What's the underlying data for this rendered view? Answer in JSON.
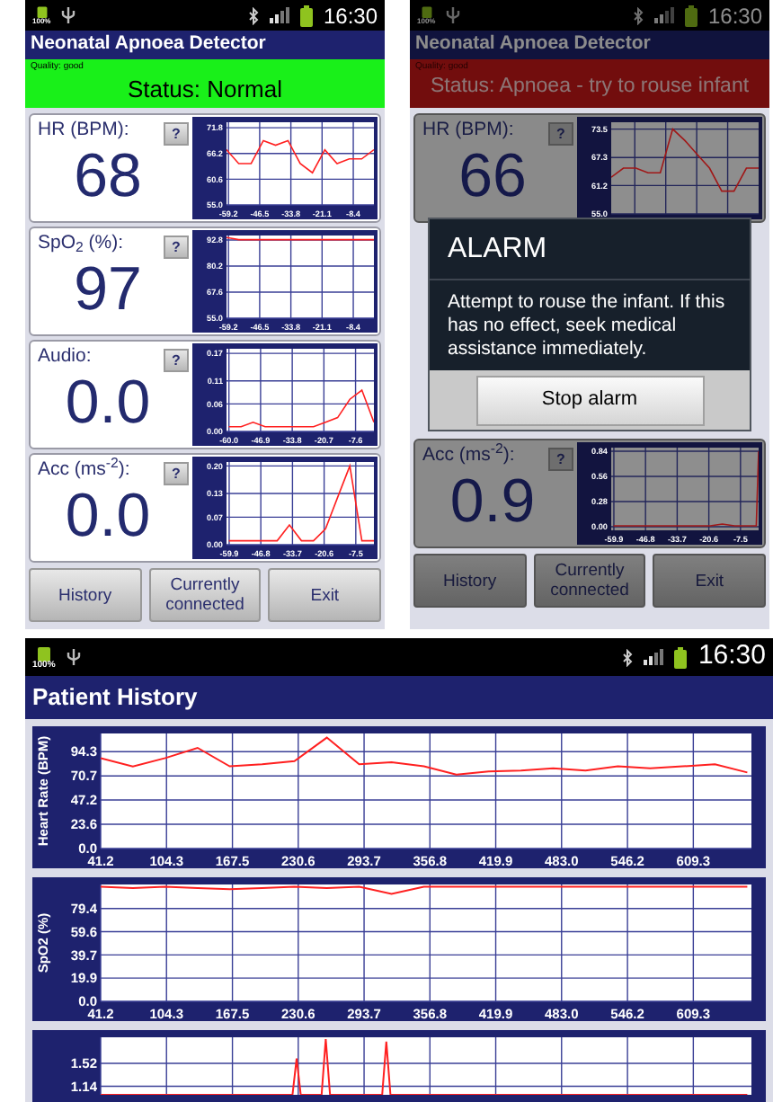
{
  "phones": [
    {
      "kind": "monitor",
      "dimmed": false,
      "status_bar": {
        "battery_label": "100%",
        "time": "16:30"
      },
      "title": "Neonatal Apnoea Detector",
      "quality": "Quality: good",
      "status": {
        "text": "Status: Normal",
        "alert": false
      },
      "cards_above": [
        {
          "label": "HR (BPM):",
          "value": "68",
          "help": "?",
          "chart_data": {
            "type": "line",
            "grid": true,
            "xlim": [
              -60,
              0
            ],
            "ylim": [
              55,
              73
            ],
            "x": [
              -60,
              -55,
              -50,
              -45,
              -40,
              -35,
              -30,
              -25,
              -20,
              -15,
              -10,
              -5,
              0
            ],
            "xticks": [
              {
                "value": -59.2,
                "label": "-59.2"
              },
              {
                "value": -46.5,
                "label": "-46.5"
              },
              {
                "value": -33.8,
                "label": "-33.8"
              },
              {
                "value": -21.1,
                "label": "-21.1"
              },
              {
                "value": -8.4,
                "label": "-8.4"
              }
            ],
            "yticks": [
              {
                "value": 55,
                "label": "55.0"
              },
              {
                "value": 60.6,
                "label": "60.6"
              },
              {
                "value": 66.2,
                "label": "66.2"
              },
              {
                "value": 71.8,
                "label": "71.8"
              }
            ],
            "series": [
              {
                "color": "#ff2020",
                "values": [
                  67,
                  64,
                  64,
                  69,
                  68,
                  69,
                  64,
                  62,
                  67,
                  64,
                  65,
                  65,
                  67
                ]
              }
            ]
          }
        },
        {
          "label": "SpO$_{2}$ (%):",
          "value": "97",
          "help": "?",
          "chart_data": {
            "type": "line",
            "grid": true,
            "xlim": [
              -60,
              0
            ],
            "ylim": [
              55,
              95
            ],
            "x": [
              -60,
              -55,
              -50,
              -45,
              -40,
              -35,
              -30,
              -25,
              -20,
              -15,
              -10,
              -5,
              0
            ],
            "xticks": [
              {
                "value": -59.2,
                "label": "-59.2"
              },
              {
                "value": -46.5,
                "label": "-46.5"
              },
              {
                "value": -33.8,
                "label": "-33.8"
              },
              {
                "value": -21.1,
                "label": "-21.1"
              },
              {
                "value": -8.4,
                "label": "-8.4"
              }
            ],
            "yticks": [
              {
                "value": 55,
                "label": "55.0"
              },
              {
                "value": 67.6,
                "label": "67.6"
              },
              {
                "value": 80.2,
                "label": "80.2"
              },
              {
                "value": 92.8,
                "label": "92.8"
              }
            ],
            "series": [
              {
                "color": "#ff2020",
                "values": [
                  94,
                  93,
                  93,
                  93,
                  93,
                  93,
                  93,
                  93,
                  93,
                  93,
                  93,
                  93,
                  93
                ]
              }
            ]
          }
        },
        {
          "label": "Audio:",
          "value": "0.0",
          "help": "?",
          "chart_data": {
            "type": "line",
            "grid": true,
            "xlim": [
              -61,
              0
            ],
            "ylim": [
              0,
              0.18
            ],
            "x": [
              -60,
              -55,
              -50,
              -45,
              -40,
              -35,
              -30,
              -25,
              -20,
              -15,
              -10,
              -5,
              0
            ],
            "xticks": [
              {
                "value": -60,
                "label": "-60.0"
              },
              {
                "value": -46.9,
                "label": "-46.9"
              },
              {
                "value": -33.8,
                "label": "-33.8"
              },
              {
                "value": -20.7,
                "label": "-20.7"
              },
              {
                "value": -7.6,
                "label": "-7.6"
              }
            ],
            "yticks": [
              {
                "value": 0,
                "label": "0.00"
              },
              {
                "value": 0.06,
                "label": "0.06"
              },
              {
                "value": 0.11,
                "label": "0.11"
              },
              {
                "value": 0.17,
                "label": "0.17"
              }
            ],
            "series": [
              {
                "color": "#ff2020",
                "values": [
                  0.01,
                  0.01,
                  0.02,
                  0.01,
                  0.01,
                  0.01,
                  0.01,
                  0.01,
                  0.02,
                  0.03,
                  0.07,
                  0.09,
                  0.02
                ]
              }
            ]
          }
        },
        {
          "label": "Acc (ms$^{-2}$):",
          "value": "0.0",
          "help": "?",
          "chart_data": {
            "type": "line",
            "grid": true,
            "xlim": [
              -61,
              0
            ],
            "ylim": [
              0,
              0.21
            ],
            "x": [
              -60,
              -55,
              -50,
              -45,
              -40,
              -35,
              -30,
              -25,
              -20,
              -15,
              -10,
              -5,
              0
            ],
            "xticks": [
              {
                "value": -59.9,
                "label": "-59.9"
              },
              {
                "value": -46.8,
                "label": "-46.8"
              },
              {
                "value": -33.7,
                "label": "-33.7"
              },
              {
                "value": -20.6,
                "label": "-20.6"
              },
              {
                "value": -7.5,
                "label": "-7.5"
              }
            ],
            "yticks": [
              {
                "value": 0,
                "label": "0.00"
              },
              {
                "value": 0.07,
                "label": "0.07"
              },
              {
                "value": 0.13,
                "label": "0.13"
              },
              {
                "value": 0.2,
                "label": "0.20"
              }
            ],
            "series": [
              {
                "color": "#ff2020",
                "values": [
                  0.01,
                  0.01,
                  0.01,
                  0.01,
                  0.01,
                  0.05,
                  0.01,
                  0.01,
                  0.04,
                  0.12,
                  0.2,
                  0.01,
                  0.01
                ]
              }
            ]
          }
        }
      ],
      "buttons": [
        "History",
        "Currently connected",
        "Exit"
      ]
    },
    {
      "kind": "monitor",
      "dimmed": true,
      "status_bar": {
        "battery_label": "100%",
        "time": "16:30"
      },
      "title": "Neonatal Apnoea Detector",
      "quality": "Quality: good",
      "status": {
        "text": "Status: Apnoea - try to rouse infant",
        "alert": true
      },
      "cards_above": [
        {
          "label": "HR (BPM):",
          "value": "66",
          "help": "?",
          "chart_data": {
            "type": "line",
            "grid": true,
            "ylim": [
              55,
              75
            ],
            "categories": [
              null,
              null,
              null,
              null,
              null,
              null,
              null,
              null,
              null,
              null,
              null,
              null,
              null
            ],
            "yticks": [
              {
                "value": 55,
                "label": "55.0"
              },
              {
                "value": 61.2,
                "label": "61.2"
              },
              {
                "value": 67.3,
                "label": "67.3"
              },
              {
                "value": 73.5,
                "label": "73.5"
              }
            ],
            "series": [
              {
                "color": "#a01818",
                "values": [
                  63,
                  65,
                  65,
                  64,
                  64,
                  73.5,
                  71,
                  68,
                  65,
                  60,
                  60,
                  65,
                  65
                ]
              }
            ]
          }
        }
      ],
      "dialog": {
        "title": "ALARM",
        "message": "Attempt to rouse the infant. If this has no effect, seek medical assistance immediately.",
        "button": "Stop alarm"
      },
      "cards_below": [
        {
          "label": "Acc (ms$^{-2}$):",
          "value": "0.9",
          "help": "?",
          "chart_data": {
            "type": "line",
            "grid": true,
            "xlim": [
              -61,
              0
            ],
            "ylim": [
              -0.04,
              0.88
            ],
            "x": [
              -60,
              -55,
              -50,
              -45,
              -40,
              -35,
              -30,
              -25,
              -20,
              -15,
              -10,
              -5,
              -1,
              0
            ],
            "xticks": [
              {
                "value": -59.9,
                "label": "-59.9"
              },
              {
                "value": -46.8,
                "label": "-46.8"
              },
              {
                "value": -33.7,
                "label": "-33.7"
              },
              {
                "value": -20.6,
                "label": "-20.6"
              },
              {
                "value": -7.5,
                "label": "-7.5"
              }
            ],
            "yticks": [
              {
                "value": 0,
                "label": "0.00"
              },
              {
                "value": 0.28,
                "label": "0.28"
              },
              {
                "value": 0.56,
                "label": "0.56"
              },
              {
                "value": 0.84,
                "label": "0.84"
              }
            ],
            "series": [
              {
                "color": "#a01818",
                "values": [
                  0.01,
                  0.01,
                  0.01,
                  0.01,
                  0.01,
                  0.01,
                  0.01,
                  0.01,
                  0.01,
                  0.03,
                  0.01,
                  0.01,
                  0.01,
                  0.84
                ]
              }
            ]
          }
        }
      ],
      "buttons": [
        "History",
        "Currently connected",
        "Exit"
      ]
    },
    {
      "kind": "history",
      "status_bar": {
        "battery_label": "100%",
        "time": "16:30"
      },
      "title": "Patient History",
      "charts": [
        {
          "chart_data": {
            "type": "line",
            "grid": true,
            "ylabel": "Heart Rate (BPM)",
            "xlim": [
              41.2,
              665
            ],
            "ylim": [
              0,
              112
            ],
            "x": [
              41.2,
              72,
              103,
              134,
              165,
              196,
              227,
              258,
              289,
              320,
              351,
              382,
              413,
              444,
              475,
              506,
              537,
              568,
              599,
              630,
              661
            ],
            "xticks": [
              {
                "value": 41.2,
                "label": "41.2"
              },
              {
                "value": 104.3,
                "label": "104.3"
              },
              {
                "value": 167.5,
                "label": "167.5"
              },
              {
                "value": 230.6,
                "label": "230.6"
              },
              {
                "value": 293.7,
                "label": "293.7"
              },
              {
                "value": 356.8,
                "label": "356.8"
              },
              {
                "value": 419.9,
                "label": "419.9"
              },
              {
                "value": 483,
                "label": "483.0"
              },
              {
                "value": 546.2,
                "label": "546.2"
              },
              {
                "value": 609.3,
                "label": "609.3"
              }
            ],
            "yticks": [
              {
                "value": 0,
                "label": "0.0"
              },
              {
                "value": 23.6,
                "label": "23.6"
              },
              {
                "value": 47.2,
                "label": "47.2"
              },
              {
                "value": 70.7,
                "label": "70.7"
              },
              {
                "value": 94.3,
                "label": "94.3"
              }
            ],
            "series": [
              {
                "color": "#ff2020",
                "values": [
                  88,
                  80,
                  88,
                  98,
                  80,
                  82,
                  85,
                  108,
                  82,
                  84,
                  80,
                  72,
                  75,
                  76,
                  78,
                  76,
                  80,
                  78,
                  80,
                  82,
                  74
                ]
              }
            ]
          }
        },
        {
          "chart_data": {
            "type": "line",
            "grid": true,
            "ylabel": "SpO2 (%)",
            "xlim": [
              41.2,
              665
            ],
            "ylim": [
              0,
              100
            ],
            "x": [
              41.2,
              72,
              103,
              134,
              165,
              196,
              227,
              258,
              289,
              320,
              351,
              382,
              413,
              444,
              475,
              506,
              537,
              568,
              599,
              630,
              661
            ],
            "xticks": [
              {
                "value": 41.2,
                "label": "41.2"
              },
              {
                "value": 104.3,
                "label": "104.3"
              },
              {
                "value": 167.5,
                "label": "167.5"
              },
              {
                "value": 230.6,
                "label": "230.6"
              },
              {
                "value": 293.7,
                "label": "293.7"
              },
              {
                "value": 356.8,
                "label": "356.8"
              },
              {
                "value": 419.9,
                "label": "419.9"
              },
              {
                "value": 483,
                "label": "483.0"
              },
              {
                "value": 546.2,
                "label": "546.2"
              },
              {
                "value": 609.3,
                "label": "609.3"
              }
            ],
            "yticks": [
              {
                "value": 0,
                "label": "0.0"
              },
              {
                "value": 19.9,
                "label": "19.9"
              },
              {
                "value": 39.7,
                "label": "39.7"
              },
              {
                "value": 59.6,
                "label": "59.6"
              },
              {
                "value": 79.4,
                "label": "79.4"
              }
            ],
            "series": [
              {
                "color": "#ff2020",
                "values": [
                  98,
                  97,
                  98,
                  97,
                  96,
                  97,
                  98,
                  97,
                  98,
                  92,
                  98,
                  98,
                  98,
                  98,
                  98,
                  98,
                  98,
                  98,
                  98,
                  98,
                  98
                ]
              }
            ]
          }
        },
        {
          "chart_data": {
            "type": "line",
            "grid": true,
            "xlim": [
              41.2,
              665
            ],
            "ylim": [
              1.0,
              1.95
            ],
            "x": [
              41.2,
              225,
              229,
              233,
              253,
              257,
              261,
              311,
              315,
              319,
              661
            ],
            "yticks": [
              {
                "value": 1.14,
                "label": "1.14"
              },
              {
                "value": 1.52,
                "label": "1.52"
              }
            ],
            "series": [
              {
                "color": "#ff2020",
                "values": [
                  1.0,
                  1.0,
                  1.6,
                  1.0,
                  1.0,
                  1.92,
                  1.0,
                  1.0,
                  1.88,
                  1.0,
                  1.0
                ]
              }
            ]
          }
        }
      ]
    }
  ]
}
